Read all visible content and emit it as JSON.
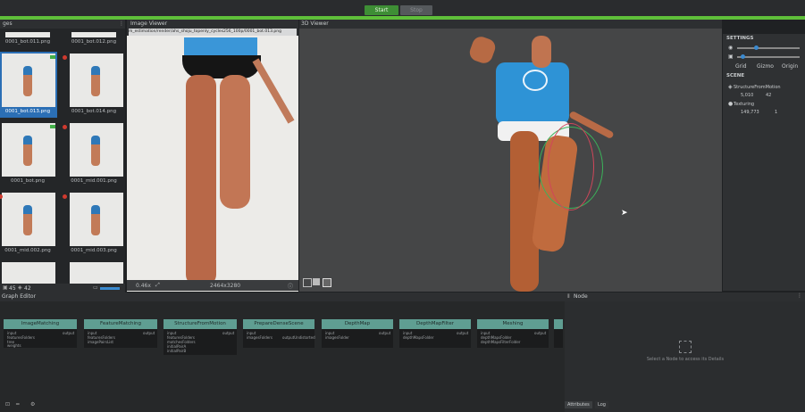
{
  "toolbar": {
    "start_label": "Start",
    "stop_label": "Stop"
  },
  "images_panel": {
    "title": "ges",
    "thumbnails": [
      {
        "label": "0001_bot.011.png"
      },
      {
        "label": "0001_bot.012.png"
      },
      {
        "label": "0001_bot.013.png"
      },
      {
        "label": "0001_bot.014.png"
      },
      {
        "label": "0001_bot.png"
      },
      {
        "label": "0001_mid.001.png"
      },
      {
        "label": "0001_mid.002.png"
      },
      {
        "label": "0001_mid.003.png"
      }
    ],
    "footer_count_a": "45",
    "footer_count_b": "42"
  },
  "image_viewer": {
    "title": "Image Viewer",
    "path": "m_estimation/render/ahs_shoju_topenly_cycles256_100p/0001_bot.013.png",
    "zoom": "0.46x",
    "resolution": "2464x3280"
  },
  "viewer3d": {
    "title": "3D Viewer"
  },
  "settings": {
    "title": "SETTINGS",
    "grid_label": "Grid",
    "gizmo_label": "Gizmo",
    "origin_label": "Origin",
    "scene_title": "SCENE",
    "sfm_label": "StructureFromMotion",
    "sfm_cameras": "5,010",
    "sfm_points": "42",
    "texturing_label": "Texturing",
    "texturing_count": "149,773",
    "texturing_count_b": "1"
  },
  "graph_editor": {
    "title": "Graph Editor",
    "nodes": [
      {
        "title": "ImageMatching",
        "ports": [
          "input",
          "featuresFolders",
          "tree",
          "weights"
        ],
        "out": "output"
      },
      {
        "title": "FeatureMatching",
        "ports": [
          "input",
          "featuresFolders",
          "imagePairsList"
        ],
        "out": "output"
      },
      {
        "title": "StructureFromMotion",
        "ports": [
          "input",
          "featuresFolders",
          "matchesFolders",
          "initialPairA",
          "initialPairB"
        ],
        "out": "output"
      },
      {
        "title": "PrepareDenseScene",
        "ports": [
          "input",
          "imagesFolders"
        ],
        "out": "outputUndistorted"
      },
      {
        "title": "DepthMap",
        "ports": [
          "input",
          "imagesFolder"
        ],
        "out": "output"
      },
      {
        "title": "DepthMapFilter",
        "ports": [
          "input",
          "depthMapsFolder"
        ],
        "out": "output"
      },
      {
        "title": "Meshing",
        "ports": [
          "input",
          "depthMapsFolder",
          "depthMapsFilterFolder"
        ],
        "out": "output"
      }
    ]
  },
  "node_panel": {
    "title": "Node",
    "placeholder": "Select a Node to access its Details",
    "tab_attributes": "Attributes",
    "tab_log": "Log"
  }
}
